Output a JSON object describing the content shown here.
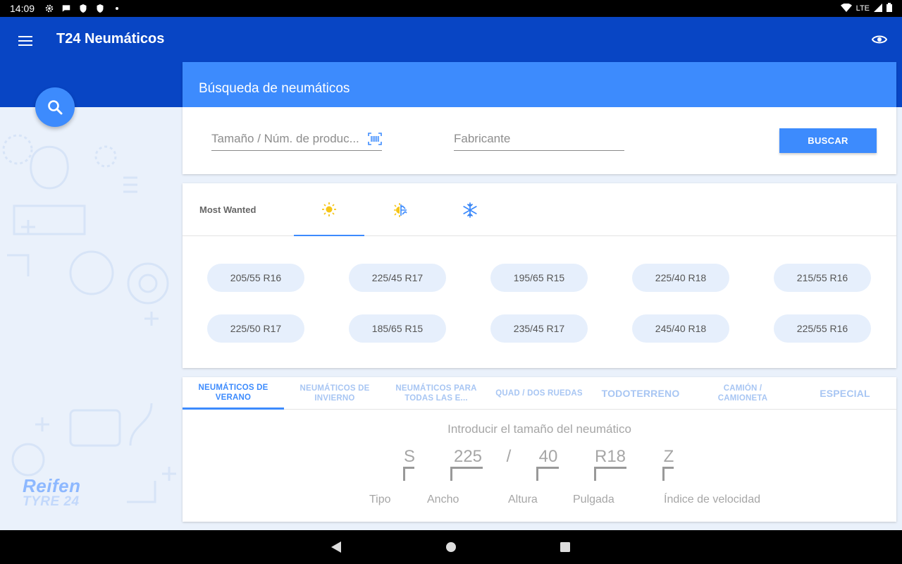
{
  "status_bar": {
    "time": "14:09",
    "network": "LTE"
  },
  "app": {
    "title": "T24 Neumáticos"
  },
  "search": {
    "title": "Búsqueda de neumáticos",
    "size_placeholder": "Tamaño / Núm. de produc...",
    "maker_placeholder": "Fabricante",
    "button": "BUSCAR"
  },
  "most_wanted": {
    "label": "Most Wanted",
    "tabs": [
      {
        "icon": "sun-icon",
        "glyph": "☀",
        "color": "#f5c518"
      },
      {
        "icon": "all-season-icon",
        "glyph": "☀❄",
        "color": "#f5c518"
      },
      {
        "icon": "snowflake-icon",
        "glyph": "❄",
        "color": "#3d8bfd"
      }
    ],
    "sizes": [
      "205/55 R16",
      "225/45 R17",
      "195/65 R15",
      "225/40 R18",
      "215/55 R16",
      "225/50 R17",
      "185/65 R15",
      "235/45 R17",
      "245/40 R18",
      "225/55 R16"
    ]
  },
  "categories": {
    "tabs": [
      {
        "label": "NEUMÁTICOS DE VERANO"
      },
      {
        "label": "NEUMÁTICOS DE INVIERNO"
      },
      {
        "label": "NEUMÁTICOS PARA TODAS LAS E..."
      },
      {
        "label": "QUAD / DOS RUEDAS"
      },
      {
        "label": "TODOTERRENO"
      },
      {
        "label": "CAMIÓN / CAMIONETA"
      },
      {
        "label": "ESPECIAL"
      }
    ]
  },
  "tyre_size": {
    "title": "Introducir el tamaño del neumático",
    "tipo_value": "S",
    "ancho_value": "225",
    "separator": "/",
    "altura_value": "40",
    "pulgada_value": "R18",
    "indice_value": "Z",
    "labels": {
      "tipo": "Tipo",
      "ancho": "Ancho",
      "altura": "Altura",
      "pulgada": "Pulgada",
      "indice": "Índice de velocidad"
    }
  },
  "logo": {
    "line1": "Reifen",
    "line2": "TYRE 24"
  },
  "colors": {
    "app_bar": "#0845c4",
    "accent": "#3d8bfd",
    "chip": "#e6effc"
  }
}
